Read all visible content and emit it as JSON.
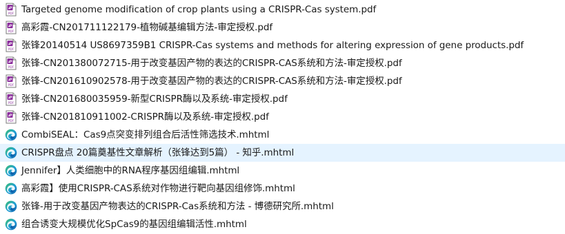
{
  "files": [
    {
      "name": "Targeted genome modification of crop plants using a CRISPR-Cas system.pdf",
      "icon": "pdf-icon"
    },
    {
      "name": "高彩霞-CN201711122179-植物碱基编辑方法-审定授权.pdf",
      "icon": "pdf-icon"
    },
    {
      "name": "张锋20140514 US8697359B1 CRISPR-Cas systems and methods for altering expression of gene products.pdf",
      "icon": "pdf-icon"
    },
    {
      "name": "张锋-CN201380072715-用于改变基因产物的表达的CRISPR-CAS系统和方法-审定授权.pdf",
      "icon": "pdf-icon"
    },
    {
      "name": "张锋-CN201610902578-用于改变基因产物的表达的CRISPR-CAS系统和方法-审定授权.pdf",
      "icon": "pdf-icon"
    },
    {
      "name": "张锋-CN201680035959-新型CRISPR酶以及系统-审定授权.pdf",
      "icon": "pdf-icon"
    },
    {
      "name": "张锋-CN201810911002-CRISPR酶以及系统-审定授权.pdf",
      "icon": "pdf-icon"
    },
    {
      "name": "CombiSEAL：Cas9点突变排列组合后活性筛选技术.mhtml",
      "icon": "edge-icon"
    },
    {
      "name": "CRISPR盘点   20篇奠基性文章解析（张锋达到5篇） - 知乎.mhtml",
      "icon": "edge-icon"
    },
    {
      "name": "Jennifer】人类细胞中的RNA程序基因组编辑.mhtml",
      "icon": "edge-icon"
    },
    {
      "name": "高彩霞】使用CRISPR-CAS系统对作物进行靶向基因组修饰.mhtml",
      "icon": "edge-icon"
    },
    {
      "name": "张锋-用于改变基因产物表达的CRISPR-Cas系统和方法 - 博德研究所.mhtml",
      "icon": "edge-icon"
    },
    {
      "name": "组合诱变大规模优化SpCas9的基因组编辑活性.mhtml",
      "icon": "edge-icon"
    }
  ],
  "hovered_index": 8,
  "colors": {
    "pdf_accent": "#8b2d9c",
    "edge_blue": "#0c59a4",
    "edge_green": "#3ec06e",
    "hover_bg": "#e5f3ff"
  }
}
